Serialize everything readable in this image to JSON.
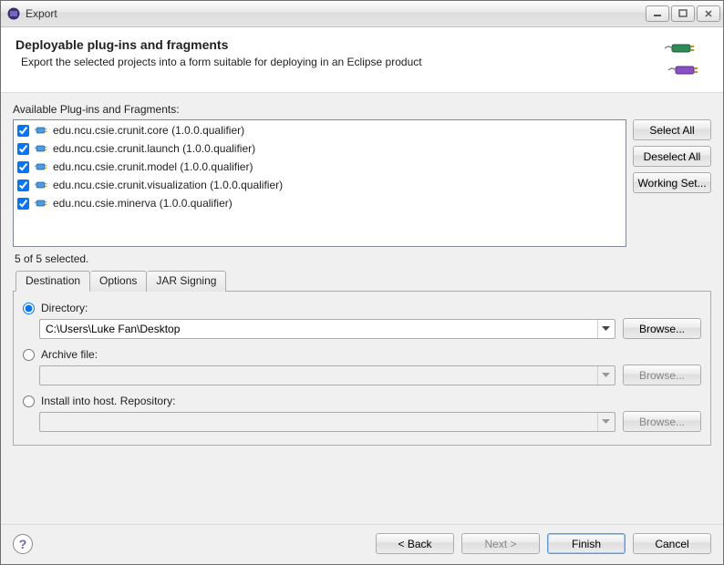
{
  "window": {
    "title": "Export"
  },
  "header": {
    "title": "Deployable plug-ins and fragments",
    "description": "Export the selected projects into a form suitable for deploying in an Eclipse product"
  },
  "available": {
    "label": "Available Plug-ins and Fragments:",
    "items": [
      {
        "checked": true,
        "name": "edu.ncu.csie.crunit.core (1.0.0.qualifier)"
      },
      {
        "checked": true,
        "name": "edu.ncu.csie.crunit.launch (1.0.0.qualifier)"
      },
      {
        "checked": true,
        "name": "edu.ncu.csie.crunit.model (1.0.0.qualifier)"
      },
      {
        "checked": true,
        "name": "edu.ncu.csie.crunit.visualization (1.0.0.qualifier)"
      },
      {
        "checked": true,
        "name": "edu.ncu.csie.minerva (1.0.0.qualifier)"
      }
    ],
    "selected_count": "5 of 5 selected."
  },
  "side_buttons": {
    "select_all": "Select All",
    "deselect_all": "Deselect All",
    "working_set": "Working Set..."
  },
  "tabs": {
    "destination": "Destination",
    "options": "Options",
    "jar_signing": "JAR Signing"
  },
  "destination": {
    "directory_label": "Directory:",
    "directory_value": "C:\\Users\\Luke Fan\\Desktop",
    "archive_label": "Archive file:",
    "archive_value": "",
    "install_label": "Install into host. Repository:",
    "install_value": "",
    "browse": "Browse..."
  },
  "buttons": {
    "back": "< Back",
    "next": "Next >",
    "finish": "Finish",
    "cancel": "Cancel"
  }
}
